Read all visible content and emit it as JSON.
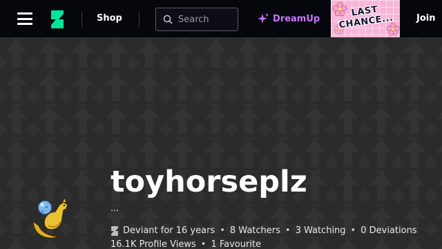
{
  "header": {
    "shop_label": "Shop",
    "search_placeholder": "Search",
    "dreamup_label": "DreamUp",
    "promo_text_1": "LAST",
    "promo_text_2": "CHANCE...",
    "join_label": "Join"
  },
  "profile": {
    "username": "toyhorseplz",
    "tagline": "...",
    "deviant_for": "Deviant for 16 years",
    "watchers": "8 Watchers",
    "watching": "3 Watching",
    "deviations": "0 Deviations",
    "profile_views": "16.1K Profile Views",
    "favourites": "1 Favourite"
  },
  "colors": {
    "topbar": "#06070d",
    "brand_green": "#00e59b",
    "dreamup_purple": "#c476ff",
    "banner_bg": "#2a2a2b"
  },
  "icons": [
    "menu-icon",
    "deviantart-logo-icon",
    "search-icon",
    "sparkle-icon"
  ]
}
